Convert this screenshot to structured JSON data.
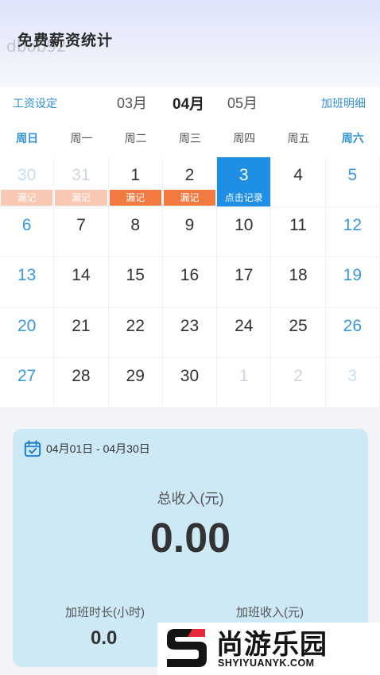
{
  "header": {
    "app_title": "免费薪资统计",
    "watermark": "dbob92"
  },
  "month_nav": {
    "salary_settings": "工资设定",
    "prev_month": "03月",
    "current_month": "04月",
    "next_month": "05月",
    "overtime_details": "加班明细"
  },
  "weekdays": [
    "周日",
    "周一",
    "周二",
    "周三",
    "周四",
    "周五",
    "周六"
  ],
  "calendar": {
    "rows": [
      [
        {
          "day": "30",
          "faded": true,
          "tag": "漏记",
          "tag_style": "missed-faded"
        },
        {
          "day": "31",
          "faded": true,
          "tag": "漏记",
          "tag_style": "missed-faded"
        },
        {
          "day": "1",
          "tag": "漏记",
          "tag_style": "missed"
        },
        {
          "day": "2",
          "tag": "漏记",
          "tag_style": "missed"
        },
        {
          "day": "3",
          "today": true,
          "tag": "点击记录",
          "tag_style": "today"
        },
        {
          "day": "4"
        },
        {
          "day": "5"
        }
      ],
      [
        {
          "day": "6"
        },
        {
          "day": "7"
        },
        {
          "day": "8"
        },
        {
          "day": "9"
        },
        {
          "day": "10"
        },
        {
          "day": "11"
        },
        {
          "day": "12"
        }
      ],
      [
        {
          "day": "13"
        },
        {
          "day": "14"
        },
        {
          "day": "15"
        },
        {
          "day": "16"
        },
        {
          "day": "17"
        },
        {
          "day": "18"
        },
        {
          "day": "19"
        }
      ],
      [
        {
          "day": "20"
        },
        {
          "day": "21"
        },
        {
          "day": "22"
        },
        {
          "day": "23"
        },
        {
          "day": "24"
        },
        {
          "day": "25"
        },
        {
          "day": "26"
        }
      ],
      [
        {
          "day": "27"
        },
        {
          "day": "28"
        },
        {
          "day": "29"
        },
        {
          "day": "30"
        },
        {
          "day": "1",
          "faded": true
        },
        {
          "day": "2",
          "faded": true
        },
        {
          "day": "3",
          "faded": true
        }
      ]
    ]
  },
  "summary": {
    "date_range": "04月01日 - 04月30日",
    "total_income_label": "总收入(元)",
    "total_income_value": "0.00",
    "overtime_hours_label": "加班时长(小时)",
    "overtime_hours_value": "0.0",
    "overtime_income_label": "加班收入(元)"
  },
  "logo": {
    "brand": "尚游乐园",
    "url": "SHYIYUANYK.COM"
  },
  "colors": {
    "accent": "#2f8fd8",
    "today_bg": "#1f8fe6",
    "missed": "#f27a40",
    "missed_faded": "#f9c8b3",
    "summary_bg": "#cde9f5"
  }
}
